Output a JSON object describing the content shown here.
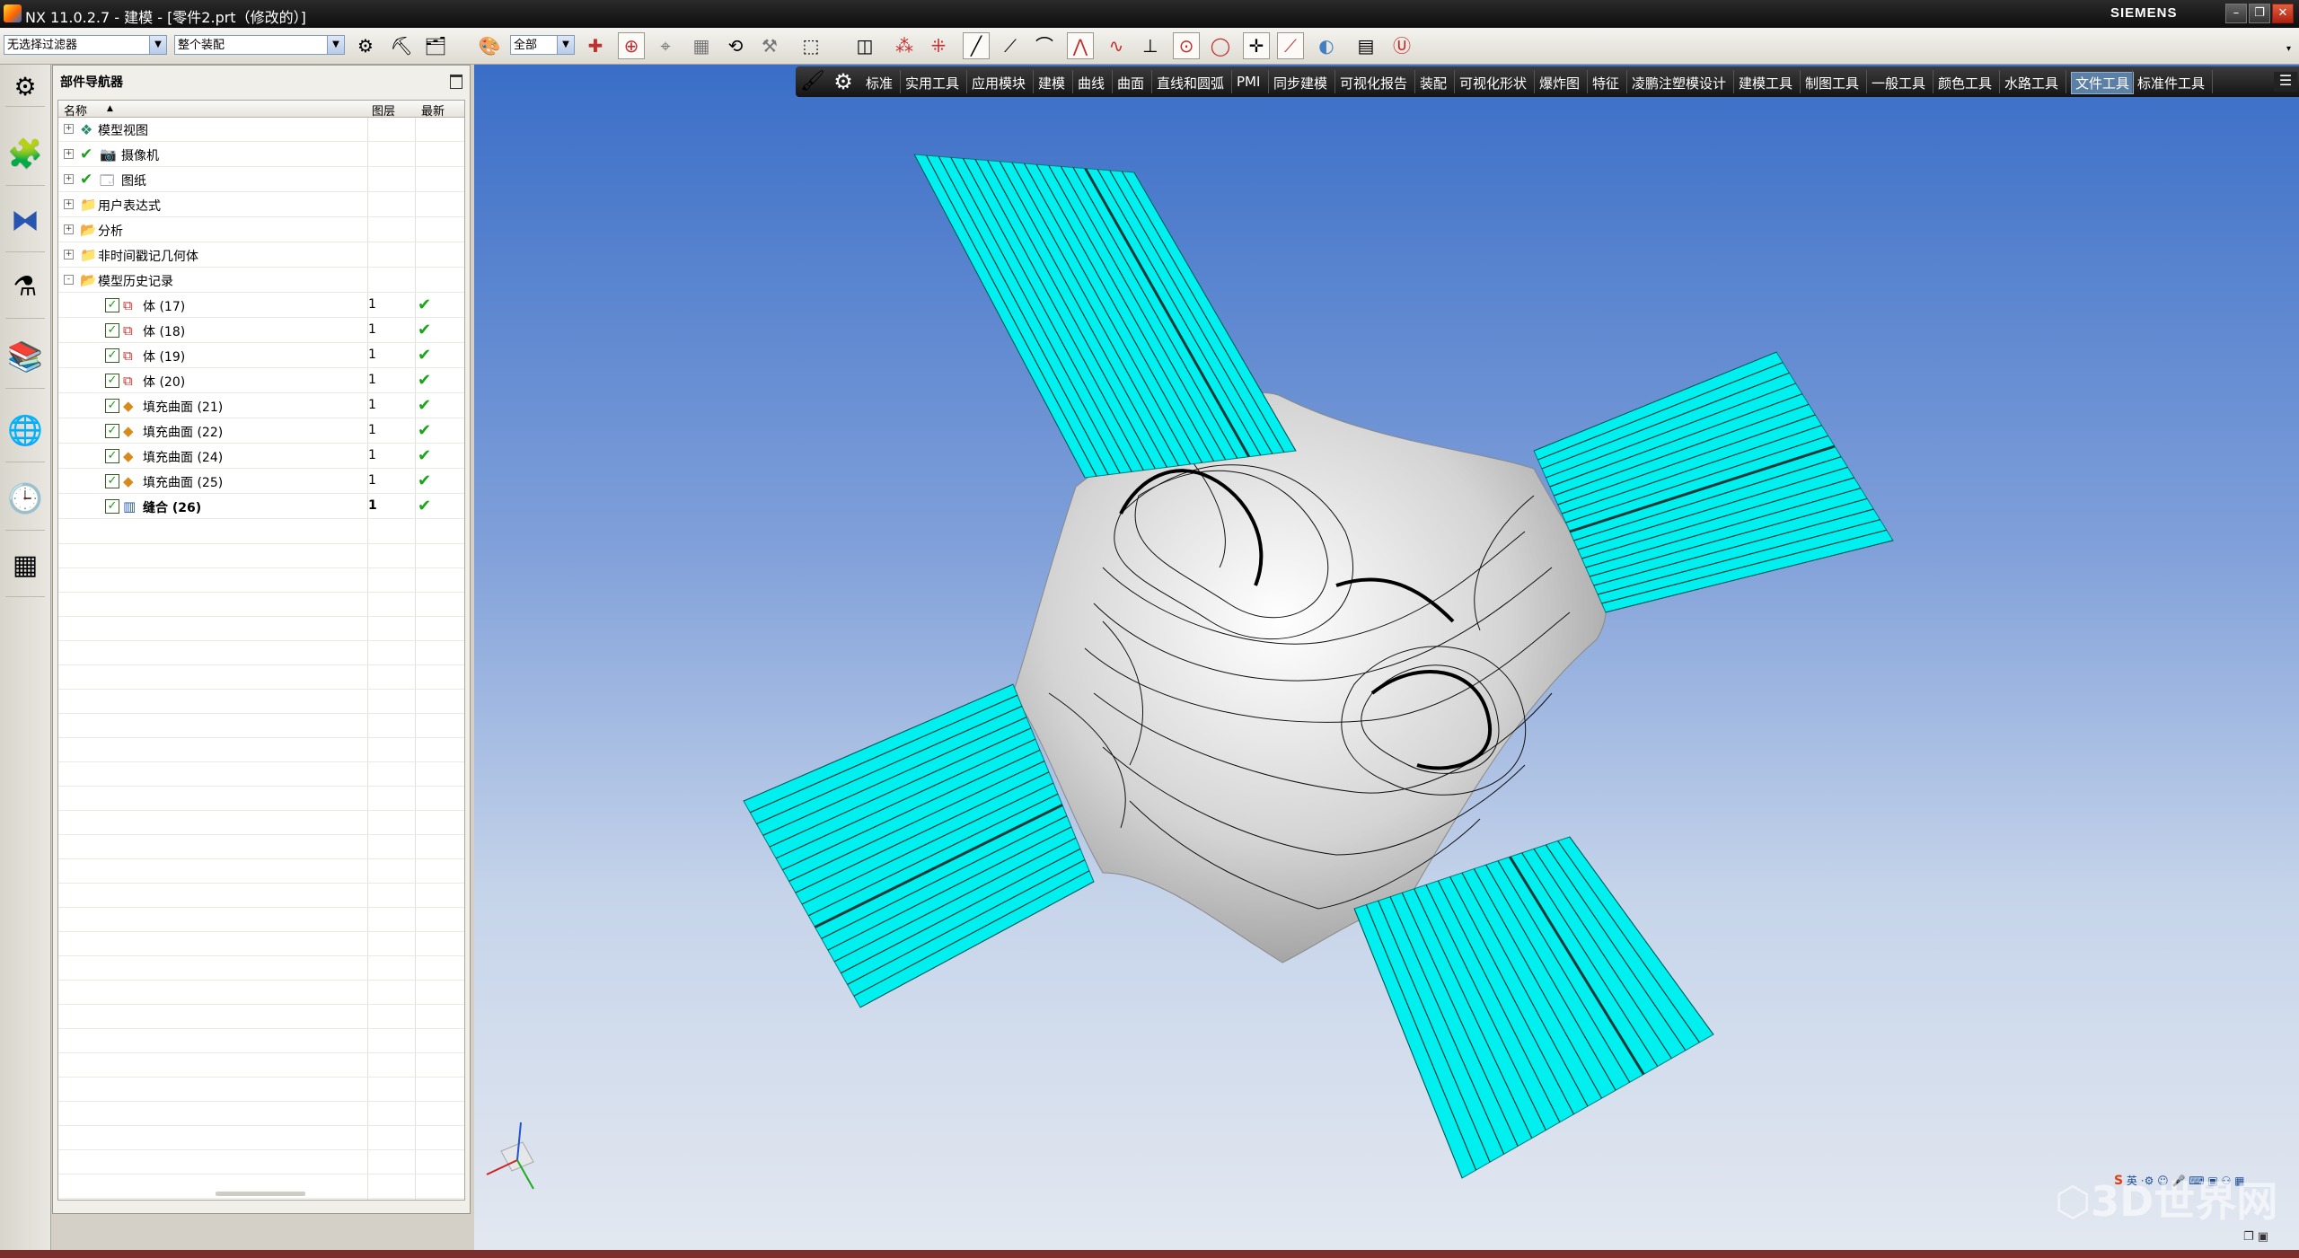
{
  "window": {
    "title": "NX 11.0.2.7 - 建模 - [零件2.prt（修改的）]",
    "brand": "SIEMENS"
  },
  "toolbar": {
    "filter_value": "无选择过滤器",
    "assembly_value": "整个装配",
    "scope_value": "全部"
  },
  "navigator": {
    "title": "部件导航器",
    "columns": [
      "名称",
      "图层",
      "最新"
    ],
    "tree": [
      {
        "label": "模型视图",
        "type": "folder-view",
        "expander": "+"
      },
      {
        "label": "摄像机",
        "type": "camera",
        "expander": "+",
        "check": true
      },
      {
        "label": "图纸",
        "type": "drawing",
        "expander": "+",
        "check": true
      },
      {
        "label": "用户表达式",
        "type": "folder",
        "expander": "+"
      },
      {
        "label": "分析",
        "type": "folder-analysis",
        "expander": "+"
      },
      {
        "label": "非时间戳记几何体",
        "type": "folder",
        "expander": "+"
      },
      {
        "label": "模型历史记录",
        "type": "folder",
        "expander": "-"
      }
    ],
    "features": [
      {
        "label": "体 (17)",
        "layer": "1",
        "latest": "✔",
        "type": "body"
      },
      {
        "label": "体 (18)",
        "layer": "1",
        "latest": "✔",
        "type": "body"
      },
      {
        "label": "体 (19)",
        "layer": "1",
        "latest": "✔",
        "type": "body"
      },
      {
        "label": "体 (20)",
        "layer": "1",
        "latest": "✔",
        "type": "body"
      },
      {
        "label": "填充曲面 (21)",
        "layer": "1",
        "latest": "✔",
        "type": "fill-surface"
      },
      {
        "label": "填充曲面 (22)",
        "layer": "1",
        "latest": "✔",
        "type": "fill-surface"
      },
      {
        "label": "填充曲面 (24)",
        "layer": "1",
        "latest": "✔",
        "type": "fill-surface"
      },
      {
        "label": "填充曲面 (25)",
        "layer": "1",
        "latest": "✔",
        "type": "fill-surface"
      },
      {
        "label": "缝合 (26)",
        "layer": "1",
        "latest": "✔",
        "type": "sew",
        "bold": true
      }
    ]
  },
  "ribbon": {
    "tabs": [
      "标准",
      "实用工具",
      "应用模块",
      "建模",
      "曲线",
      "曲面",
      "直线和圆弧",
      "PMI",
      "同步建模",
      "可视化报告",
      "装配",
      "可视化形状",
      "爆炸图",
      "特征",
      "凌鹏注塑模设计",
      "建模工具",
      "制图工具",
      "一般工具",
      "颜色工具",
      "水路工具",
      "文件工具",
      "标准件工具"
    ],
    "selected_tab": "文件工具"
  },
  "watermark": "3D世界网",
  "ime": "英",
  "colors": {
    "surface_cyan": "#00f0f0",
    "surface_gray": "#dcdcdc",
    "selected_tab": "#5c7fa6"
  }
}
